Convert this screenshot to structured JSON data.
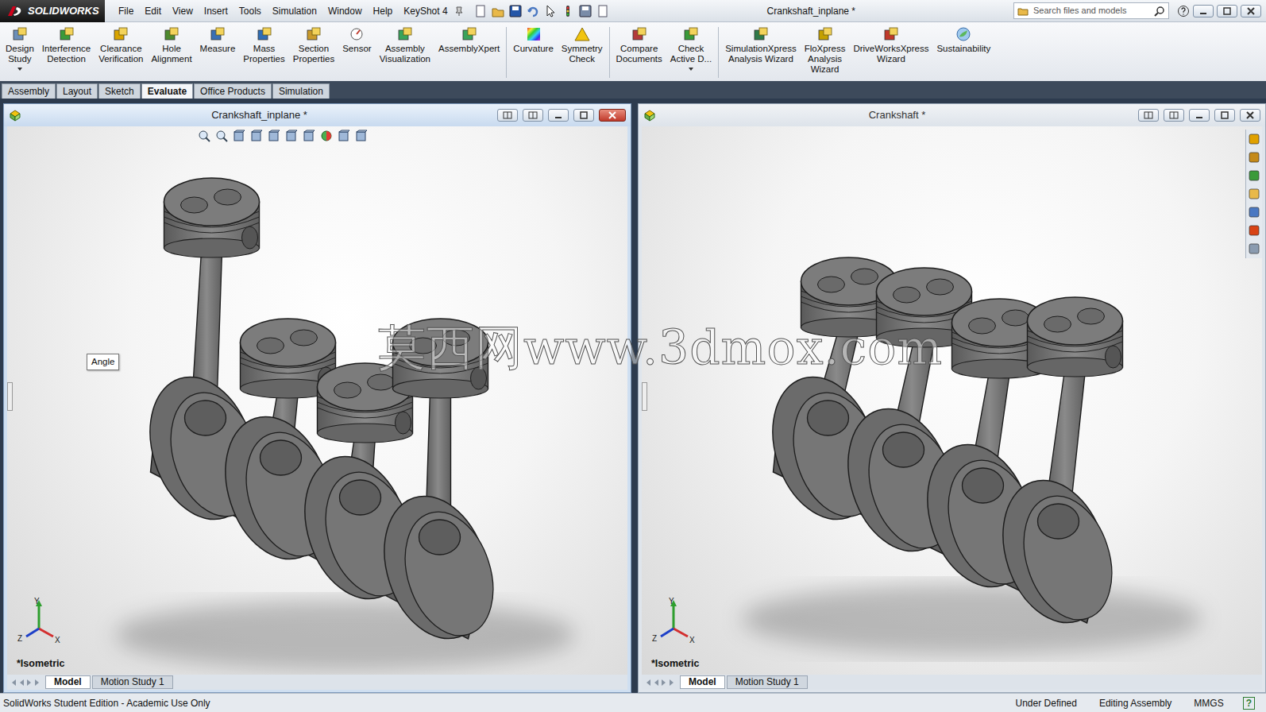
{
  "app": {
    "logo": "SOLIDWORKS"
  },
  "menu": [
    "File",
    "Edit",
    "View",
    "Insert",
    "Tools",
    "Simulation",
    "Window",
    "Help",
    "KeyShot 4"
  ],
  "window": {
    "title": "Crankshaft_inplane *"
  },
  "search": {
    "placeholder": "Search files and models"
  },
  "ribbon": [
    {
      "label": "Design\nStudy",
      "dropdown": true,
      "separator_after": false
    },
    {
      "label": "Interference\nDetection",
      "dropdown": false,
      "separator_after": false
    },
    {
      "label": "Clearance\nVerification",
      "dropdown": false,
      "separator_after": false
    },
    {
      "label": "Hole\nAlignment",
      "dropdown": false,
      "separator_after": false
    },
    {
      "label": "Measure",
      "dropdown": false,
      "separator_after": false
    },
    {
      "label": "Mass\nProperties",
      "dropdown": false,
      "separator_after": false
    },
    {
      "label": "Section\nProperties",
      "dropdown": false,
      "separator_after": false
    },
    {
      "label": "Sensor",
      "dropdown": false,
      "separator_after": false
    },
    {
      "label": "Assembly\nVisualization",
      "dropdown": false,
      "separator_after": false
    },
    {
      "label": "AssemblyXpert",
      "dropdown": false,
      "separator_after": true
    },
    {
      "label": "Curvature",
      "dropdown": false,
      "separator_after": false
    },
    {
      "label": "Symmetry\nCheck",
      "dropdown": false,
      "separator_after": true
    },
    {
      "label": "Compare\nDocuments",
      "dropdown": false,
      "separator_after": false
    },
    {
      "label": "Check\nActive D...",
      "dropdown": true,
      "separator_after": true
    },
    {
      "label": "SimulationXpress\nAnalysis Wizard",
      "dropdown": false,
      "separator_after": false
    },
    {
      "label": "FloXpress\nAnalysis\nWizard",
      "dropdown": false,
      "separator_after": false
    },
    {
      "label": "DriveWorksXpress\nWizard",
      "dropdown": false,
      "separator_after": false
    },
    {
      "label": "Sustainability",
      "dropdown": false,
      "separator_after": false
    }
  ],
  "command_tabs": [
    {
      "label": "Assembly",
      "selected": false
    },
    {
      "label": "Layout",
      "selected": false
    },
    {
      "label": "Sketch",
      "selected": false
    },
    {
      "label": "Evaluate",
      "selected": true
    },
    {
      "label": "Office Products",
      "selected": false
    },
    {
      "label": "Simulation",
      "selected": false
    }
  ],
  "documents": [
    {
      "title": "Crankshaft_inplane *",
      "active": true,
      "kind": "inplane",
      "view": "*Isometric",
      "tooltip": "Angle",
      "tabs": [
        {
          "label": "Model",
          "selected": true
        },
        {
          "label": "Motion Study 1",
          "selected": false
        }
      ]
    },
    {
      "title": "Crankshaft *",
      "active": false,
      "kind": "aligned",
      "view": "*Isometric",
      "tabs": [
        {
          "label": "Model",
          "selected": true
        },
        {
          "label": "Motion Study 1",
          "selected": false
        }
      ]
    }
  ],
  "axes": {
    "y": "Y",
    "z": "Z",
    "x": "X"
  },
  "watermark": "莫西网www.3dmox.com",
  "status_bar": [
    "SolidWorks Student Edition - Academic Use Only",
    "Under Defined",
    "Editing Assembly",
    "MMGS",
    "?"
  ]
}
